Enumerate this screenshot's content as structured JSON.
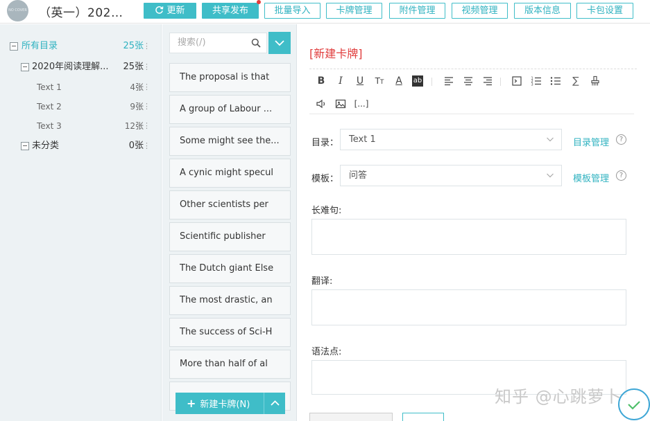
{
  "header": {
    "avatar_text": "NO COVER",
    "deck_title": "（英一）202…",
    "buttons": {
      "update": "更新",
      "share": "共享发布",
      "batch_import": "批量导入",
      "card_manage": "卡牌管理",
      "attachment_manage": "附件管理",
      "video_manage": "视频管理",
      "version_info": "版本信息",
      "deck_settings": "卡包设置"
    },
    "update_icon": "refresh-icon"
  },
  "tree": {
    "items": [
      {
        "label": "所有目录",
        "count": "25张",
        "more": "⋮"
      },
      {
        "label": "2020年阅读理解...",
        "count": "25张",
        "more": "⋮"
      },
      {
        "label": "Text 1",
        "count": "4张",
        "more": "⋮"
      },
      {
        "label": "Text 2",
        "count": "9张",
        "more": "⋮"
      },
      {
        "label": "Text 3",
        "count": "12张",
        "more": "⋮"
      },
      {
        "label": "未分类",
        "count": "0张",
        "more": "⋮"
      }
    ]
  },
  "cards": {
    "search_placeholder": "搜索(/)",
    "items": [
      "The proposal is that",
      "A group of Labour ...",
      "Some might see the...",
      "A cynic might specul",
      "Other scientists per",
      "Scientific publisher",
      "The Dutch giant Else",
      "The most drastic, an",
      "The success of Sci-H",
      "More than half of al"
    ],
    "new_card_label": "新建卡牌(N)"
  },
  "editor": {
    "title": "[新建卡牌]",
    "toolbar_more": "[...]",
    "directory": {
      "label": "目录：",
      "value": "Text 1",
      "manage": "目录管理"
    },
    "template": {
      "label": "模板：",
      "value": "问答",
      "manage": "模板管理"
    },
    "help_mark": "?",
    "fields": [
      {
        "label": "长难句:"
      },
      {
        "label": "翻译:"
      },
      {
        "label": "语法点:"
      }
    ]
  },
  "watermark": "知乎 @心跳萝卜",
  "colors": {
    "accent": "#3fbdc8",
    "title_red": "#e03c3c",
    "sidebar_bg": "#edf2f4"
  }
}
